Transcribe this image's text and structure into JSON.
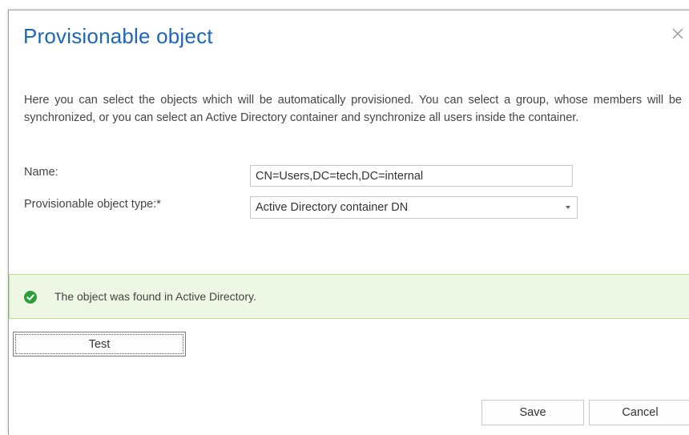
{
  "dialog": {
    "title": "Provisionable object",
    "description": "Here you can select the objects which will be automatically provisioned. You can select a group, whose members will be synchronized, or you can select an Active Directory container and synchronize all users inside the container.",
    "close_icon": "close-icon"
  },
  "form": {
    "name_label": "Name:",
    "name_value": "CN=Users,DC=tech,DC=internal",
    "type_label": "Provisionable object type:*",
    "type_value": "Active Directory container DN"
  },
  "alert": {
    "icon": "check-circle-icon",
    "text": "The object was found in Active Directory.",
    "color": "#2e9e3a"
  },
  "buttons": {
    "test": "Test",
    "save": "Save",
    "cancel": "Cancel"
  },
  "colors": {
    "title": "#1d67b4",
    "alert_bg": "#eef7e4",
    "alert_border": "#b6e08f"
  }
}
